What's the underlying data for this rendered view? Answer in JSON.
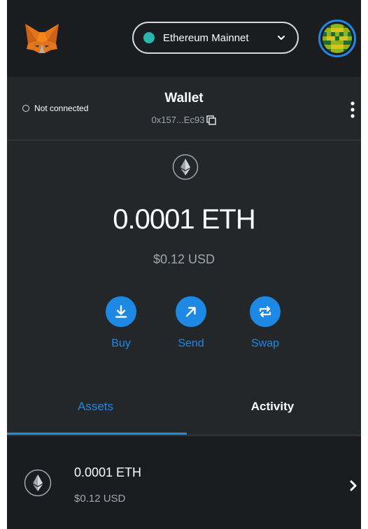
{
  "header": {
    "network": {
      "label": "Ethereum Mainnet",
      "dot_color": "#29b6af"
    },
    "logo_icon": "metamask-fox-icon",
    "avatar_icon": "account-identicon"
  },
  "account": {
    "connection_status": "Not connected",
    "name": "Wallet",
    "address": "0x157...Ec93",
    "copy_icon": "copy-icon",
    "menu_icon": "kebab-menu-icon"
  },
  "balance": {
    "token_icon": "ethereum-icon",
    "primary": "0.0001 ETH",
    "secondary": "$0.12 USD"
  },
  "actions": [
    {
      "label": "Buy",
      "icon": "download-icon"
    },
    {
      "label": "Send",
      "icon": "arrow-up-right-icon"
    },
    {
      "label": "Swap",
      "icon": "swap-icon"
    }
  ],
  "tabs": [
    {
      "label": "Assets",
      "active": true
    },
    {
      "label": "Activity",
      "active": false
    }
  ],
  "assets": [
    {
      "amount": "0.0001 ETH",
      "usd": "$0.12 USD",
      "icon": "ethereum-icon"
    }
  ],
  "colors": {
    "accent": "#1e88e5",
    "background": "#24272a",
    "header_background": "#1b1c1f",
    "muted_text": "#9fa6ae"
  }
}
